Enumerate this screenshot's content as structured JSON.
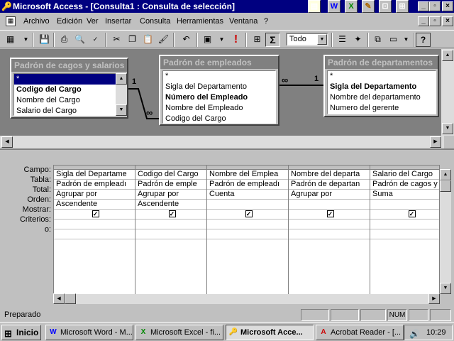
{
  "window": {
    "title": "Microsoft Access - [Consulta1 : Consulta de selección]",
    "minimize": "_",
    "restore": "▫",
    "close": "×"
  },
  "tray_icons": [
    "W",
    "X",
    "✎",
    "⊡",
    "⊞"
  ],
  "menu": {
    "items": [
      "Archivo",
      "Edición",
      "Ver",
      "Insertar",
      "Consulta",
      "Herramientas",
      "Ventana",
      "?"
    ]
  },
  "toolbar": {
    "top_value": "Todo",
    "sigma": "Σ",
    "exclaim": "!",
    "help": "?"
  },
  "tables": [
    {
      "title": "Padrón de cagos y salarios",
      "fields": [
        {
          "name": "*",
          "bold": false,
          "selected": true
        },
        {
          "name": "Codigo del Cargo",
          "bold": true,
          "selected": false
        },
        {
          "name": "Nombre del Cargo",
          "bold": false,
          "selected": false
        },
        {
          "name": "Salario del Cargo",
          "bold": false,
          "selected": false
        }
      ]
    },
    {
      "title": "Padrón de empleados",
      "fields": [
        {
          "name": "*",
          "bold": false,
          "selected": false
        },
        {
          "name": "Sigla del Departamento",
          "bold": false,
          "selected": false
        },
        {
          "name": "Número del Empleado",
          "bold": true,
          "selected": false
        },
        {
          "name": "Nombre del Empleado",
          "bold": false,
          "selected": false
        },
        {
          "name": "Codigo del Cargo",
          "bold": false,
          "selected": false
        }
      ]
    },
    {
      "title": "Padrón de departamentos",
      "fields": [
        {
          "name": "*",
          "bold": false,
          "selected": false
        },
        {
          "name": "Sigla del Departamento",
          "bold": true,
          "selected": false
        },
        {
          "name": "Nombre del departamento",
          "bold": false,
          "selected": false
        },
        {
          "name": "Numero del gerente",
          "bold": false,
          "selected": false
        }
      ]
    }
  ],
  "joins": {
    "one_label": "1",
    "many_label": "∞"
  },
  "grid": {
    "row_labels": [
      "Campo:",
      "Tabla:",
      "Total:",
      "Orden:",
      "Mostrar:",
      "Criterios:",
      "o:"
    ],
    "columns": [
      {
        "campo": "Sigla del Departame",
        "tabla": "Padrón de empleadı",
        "total": "Agrupar por",
        "orden": "Ascendente",
        "mostrar": true
      },
      {
        "campo": "Codigo del Cargo",
        "tabla": "Padrón de emple",
        "total": "Agrupar por",
        "orden": "Ascendente",
        "mostrar": true
      },
      {
        "campo": "Nombre del Emplea",
        "tabla": "Padrón de empleadı",
        "total": "Cuenta",
        "orden": "",
        "mostrar": true
      },
      {
        "campo": "Nombre del departa",
        "tabla": "Padrón de departan",
        "total": "Agrupar por",
        "orden": "",
        "mostrar": true
      },
      {
        "campo": "Salario del Cargo",
        "tabla": "Padrón de cagos y s",
        "total": "Suma",
        "orden": "",
        "mostrar": true
      }
    ]
  },
  "status": {
    "text": "Preparado",
    "num": "NUM"
  },
  "taskbar": {
    "start": "Inicio",
    "tasks": [
      {
        "icon": "W",
        "label": "Microsoft Word - M..."
      },
      {
        "icon": "X",
        "label": "Microsoft Excel - fi..."
      },
      {
        "icon": "🔑",
        "label": "Microsoft Acce..."
      },
      {
        "icon": "A",
        "label": "Acrobat Reader - [..."
      }
    ],
    "clock": "10:29"
  }
}
